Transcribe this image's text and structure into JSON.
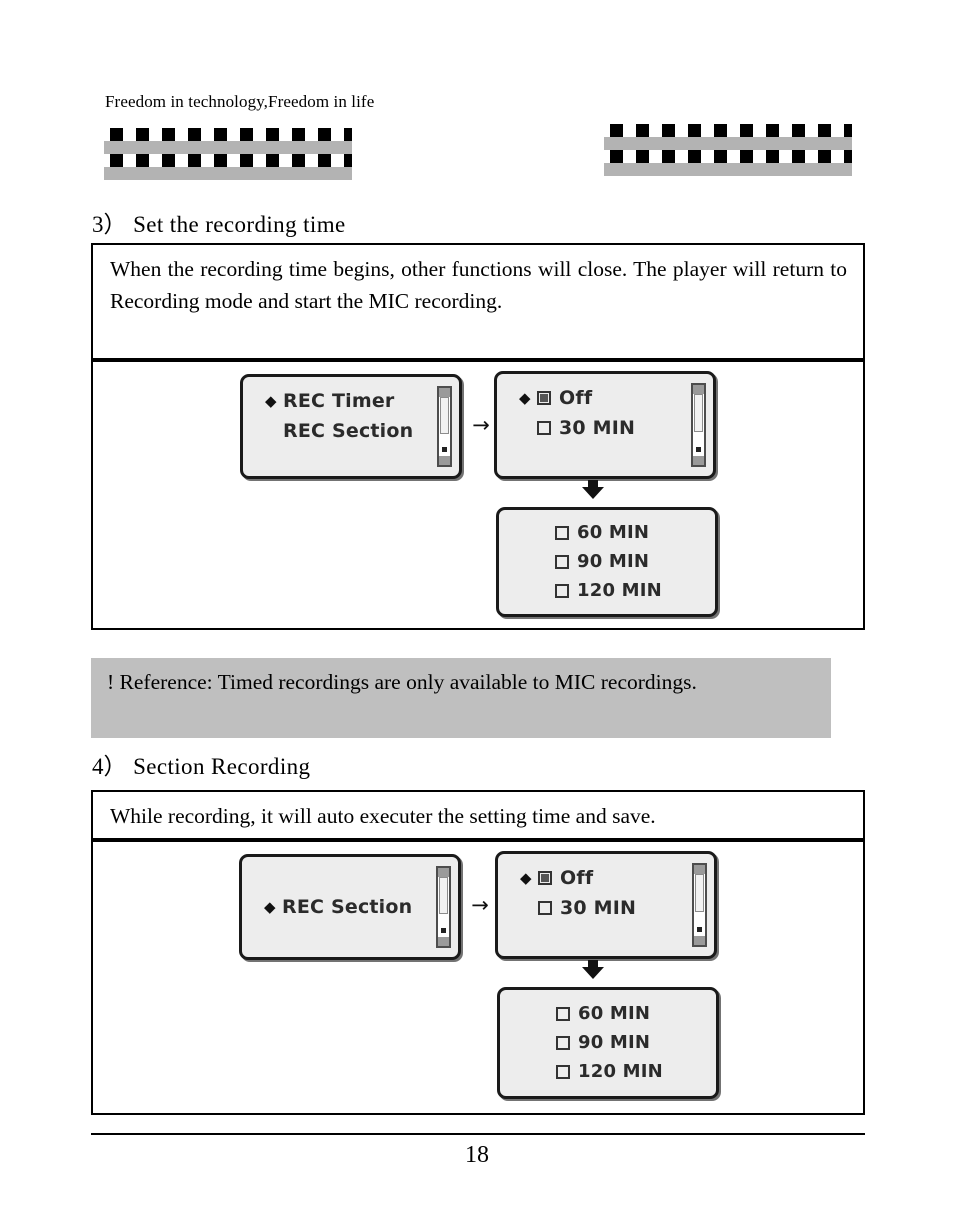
{
  "header": {
    "tagline": "Freedom in technology,Freedom in life",
    "decoration_name": "checkered-band"
  },
  "sections": [
    {
      "number": "3",
      "paren": "）",
      "title": "Set  the  recording  time",
      "body": "When the recording time begins, other functions will close. The player will return to Recording mode and start the MIC recording.",
      "diagram": {
        "menu_screen": {
          "lines": [
            {
              "bullet": "◆",
              "label": "REC Timer",
              "checkbox": "none"
            },
            {
              "bullet": "",
              "label": "REC Section",
              "checkbox": "none"
            }
          ]
        },
        "option_screen": {
          "lines": [
            {
              "bullet": "◆",
              "label": "Off",
              "checkbox": "checked"
            },
            {
              "bullet": "",
              "label": "30 MIN",
              "checkbox": "unchecked"
            }
          ]
        },
        "more_options_screen": {
          "lines": [
            {
              "bullet": "",
              "label": "60  MIN",
              "checkbox": "unchecked"
            },
            {
              "bullet": "",
              "label": "90  MIN",
              "checkbox": "unchecked"
            },
            {
              "bullet": "",
              "label": "120 MIN",
              "checkbox": "unchecked"
            }
          ]
        },
        "arrow_right": "→",
        "arrow_down": "▼"
      }
    },
    {
      "number": "4",
      "paren": "）",
      "title": "Section  Recording",
      "body": "While recording, it will auto executer the setting time and save.",
      "diagram": {
        "menu_screen": {
          "lines": [
            {
              "bullet": "◆",
              "label": "REC Section",
              "checkbox": "none"
            }
          ]
        },
        "option_screen": {
          "lines": [
            {
              "bullet": "◆",
              "label": "Off",
              "checkbox": "checked"
            },
            {
              "bullet": "",
              "label": "30 MIN",
              "checkbox": "unchecked"
            }
          ]
        },
        "more_options_screen": {
          "lines": [
            {
              "bullet": "",
              "label": "60  MIN",
              "checkbox": "unchecked"
            },
            {
              "bullet": "",
              "label": "90  MIN",
              "checkbox": "unchecked"
            },
            {
              "bullet": "",
              "label": "120 MIN",
              "checkbox": "unchecked"
            }
          ]
        },
        "arrow_right": "→",
        "arrow_down": "▼"
      }
    }
  ],
  "note": {
    "marker": "!",
    "text": "! Reference: Timed recordings are only available to MIC recordings.",
    "background": "#bfbfbf"
  },
  "footer": {
    "page_number": "18"
  },
  "colors": {
    "checker_black": "#000000",
    "checker_gray": "#b3b3b3",
    "lcd_face": "#ededed",
    "lcd_border": "#1a1a1a",
    "note_bg": "#bfbfbf"
  }
}
